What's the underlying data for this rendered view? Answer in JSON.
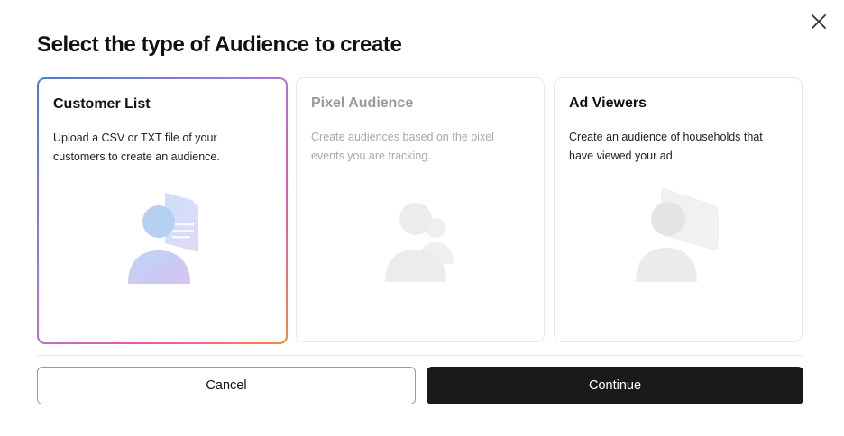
{
  "dialog": {
    "title": "Select the type of Audience to create"
  },
  "cards": [
    {
      "title": "Customer List",
      "description": "Upload a CSV or TXT file of your customers to create an audience.",
      "state": "selected",
      "icon": "person-with-document-icon"
    },
    {
      "title": "Pixel Audience",
      "description": "Create audiences based on the pixel events you are tracking.",
      "state": "disabled",
      "icon": "person-with-group-icon"
    },
    {
      "title": "Ad Viewers",
      "description": "Create an audience of households that have viewed your ad.",
      "state": "enabled",
      "icon": "person-with-screen-icon"
    }
  ],
  "footer": {
    "cancel_label": "Cancel",
    "continue_label": "Continue"
  },
  "colors": {
    "primary_button": "#1a1a1a",
    "selected_border_gradient": [
      "#4f7ad6",
      "#9a7be0",
      "#e25ab0",
      "#f08a3e"
    ],
    "disabled_text": "#9a9a9a"
  }
}
